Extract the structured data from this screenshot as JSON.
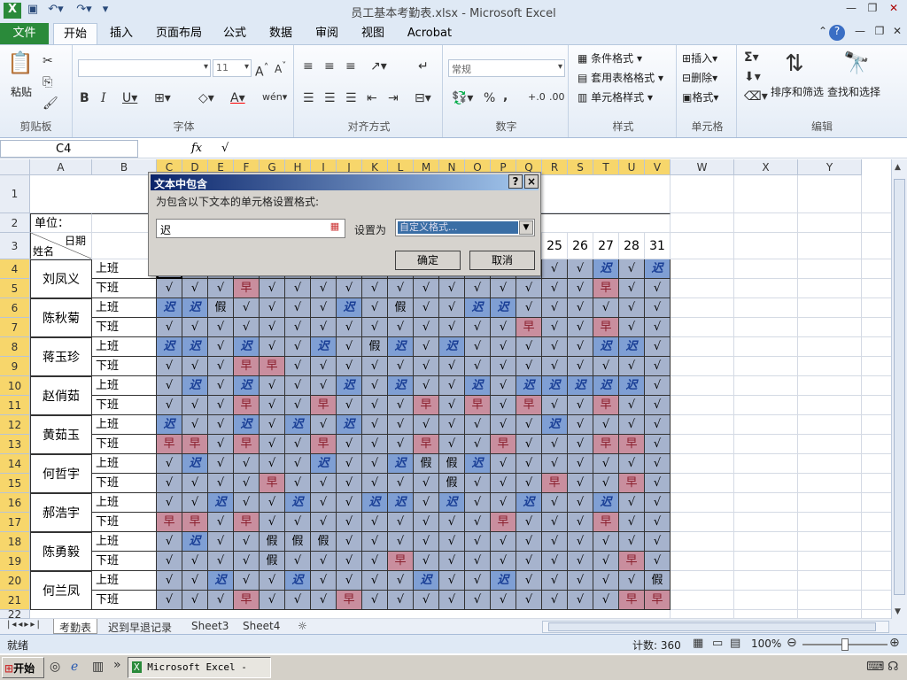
{
  "window": {
    "title": "员工基本考勤表.xlsx - Microsoft Excel"
  },
  "ribbon": {
    "tabs": [
      "文件",
      "开始",
      "插入",
      "页面布局",
      "公式",
      "数据",
      "审阅",
      "视图",
      "Acrobat"
    ],
    "clipboard": {
      "paste": "粘贴",
      "label": "剪贴板"
    },
    "font": {
      "label": "字体",
      "size": "11"
    },
    "alignment": {
      "label": "对齐方式"
    },
    "number": {
      "label": "数字",
      "format": "常规",
      "percent": "%",
      "comma": ","
    },
    "styles": {
      "label": "样式",
      "conditional": "条件格式",
      "table": "套用表格格式",
      "cell": "单元格样式"
    },
    "cells": {
      "label": "单元格",
      "insert": "插入",
      "delete": "删除",
      "format": "格式"
    },
    "editing": {
      "label": "编辑",
      "sort": "排序和筛选",
      "find": "查找和选择",
      "sigma": "Σ"
    }
  },
  "formula_bar": {
    "name_box": "C4",
    "fx": "fx",
    "value": "√"
  },
  "sheet": {
    "col_headers": [
      "A",
      "B",
      "C",
      "D",
      "E",
      "F",
      "G",
      "H",
      "I",
      "J",
      "K",
      "L",
      "M",
      "N",
      "O",
      "P",
      "Q",
      "R",
      "S",
      "T",
      "U",
      "V",
      "W",
      "X",
      "Y"
    ],
    "row_headers": [
      "1",
      "2",
      "3",
      "4",
      "5",
      "6",
      "7",
      "8",
      "9",
      "10",
      "11",
      "12",
      "13",
      "14",
      "15",
      "16",
      "17",
      "18",
      "19",
      "20",
      "21",
      "22"
    ],
    "unit_label": "单位：",
    "date_label": "日期",
    "name_label": "姓名",
    "visible_days": [
      "25",
      "26",
      "27",
      "28",
      "31"
    ],
    "shift_labels": [
      "上班",
      "下班"
    ],
    "employees": [
      "刘凤义",
      "陈秋菊",
      "蒋玉珍",
      "赵俏茹",
      "黄茹玉",
      "何哲宇",
      "郝浩宇",
      "陈勇毅",
      "何兰凤"
    ],
    "attendance": [
      [
        "",
        "",
        "",
        "",
        "",
        "",
        "",
        "",
        "",
        "",
        "",
        "",
        "",
        "",
        "",
        "√",
        "√",
        "迟",
        "√",
        "迟"
      ],
      [
        "√",
        "√",
        "√",
        "早",
        "√",
        "√",
        "√",
        "√",
        "√",
        "√",
        "√",
        "√",
        "√",
        "√",
        "√",
        "√",
        "√",
        "早",
        "√",
        "√"
      ],
      [
        "迟",
        "迟",
        "假",
        "√",
        "√",
        "√",
        "√",
        "迟",
        "√",
        "假",
        "√",
        "√",
        "迟",
        "迟",
        "√",
        "√",
        "√",
        "√",
        "√",
        "√"
      ],
      [
        "√",
        "√",
        "√",
        "√",
        "√",
        "√",
        "√",
        "√",
        "√",
        "√",
        "√",
        "√",
        "√",
        "√",
        "早",
        "√",
        "√",
        "早",
        "√",
        "√"
      ],
      [
        "迟",
        "迟",
        "√",
        "迟",
        "√",
        "√",
        "迟",
        "√",
        "假",
        "迟",
        "√",
        "迟",
        "√",
        "√",
        "√",
        "√",
        "√",
        "迟",
        "迟",
        "√"
      ],
      [
        "√",
        "√",
        "√",
        "早",
        "早",
        "√",
        "√",
        "√",
        "√",
        "√",
        "√",
        "√",
        "√",
        "√",
        "√",
        "√",
        "√",
        "√",
        "√",
        "√"
      ],
      [
        "√",
        "迟",
        "√",
        "迟",
        "√",
        "√",
        "√",
        "迟",
        "√",
        "迟",
        "√",
        "√",
        "迟",
        "√",
        "迟",
        "迟",
        "迟",
        "迟",
        "迟",
        "√"
      ],
      [
        "√",
        "√",
        "√",
        "早",
        "√",
        "√",
        "早",
        "√",
        "√",
        "√",
        "早",
        "√",
        "早",
        "√",
        "早",
        "√",
        "√",
        "早",
        "√",
        "√"
      ],
      [
        "迟",
        "√",
        "√",
        "迟",
        "√",
        "迟",
        "√",
        "迟",
        "√",
        "√",
        "√",
        "√",
        "√",
        "√",
        "√",
        "迟",
        "√",
        "√",
        "√",
        "√"
      ],
      [
        "早",
        "早",
        "√",
        "早",
        "√",
        "√",
        "早",
        "√",
        "√",
        "√",
        "早",
        "√",
        "√",
        "早",
        "√",
        "√",
        "√",
        "早",
        "早",
        "√"
      ],
      [
        "√",
        "迟",
        "√",
        "√",
        "√",
        "√",
        "迟",
        "√",
        "√",
        "迟",
        "假",
        "假",
        "迟",
        "√",
        "√",
        "√",
        "√",
        "√",
        "√",
        "√"
      ],
      [
        "√",
        "√",
        "√",
        "√",
        "早",
        "√",
        "√",
        "√",
        "√",
        "√",
        "√",
        "假",
        "√",
        "√",
        "√",
        "早",
        "√",
        "√",
        "早",
        "√"
      ],
      [
        "√",
        "√",
        "迟",
        "√",
        "√",
        "迟",
        "√",
        "√",
        "迟",
        "迟",
        "√",
        "迟",
        "√",
        "√",
        "迟",
        "√",
        "√",
        "迟",
        "√",
        "√"
      ],
      [
        "早",
        "早",
        "√",
        "早",
        "√",
        "√",
        "√",
        "√",
        "√",
        "√",
        "√",
        "√",
        "√",
        "早",
        "√",
        "√",
        "√",
        "早",
        "√",
        "√"
      ],
      [
        "√",
        "迟",
        "√",
        "√",
        "假",
        "假",
        "假",
        "√",
        "√",
        "√",
        "√",
        "√",
        "√",
        "√",
        "√",
        "√",
        "√",
        "√",
        "√",
        "√"
      ],
      [
        "√",
        "√",
        "√",
        "√",
        "假",
        "√",
        "√",
        "√",
        "√",
        "早",
        "√",
        "√",
        "√",
        "√",
        "√",
        "√",
        "√",
        "√",
        "早",
        "√"
      ],
      [
        "√",
        "√",
        "迟",
        "√",
        "√",
        "迟",
        "√",
        "√",
        "√",
        "√",
        "迟",
        "√",
        "√",
        "迟",
        "√",
        "√",
        "√",
        "√",
        "√",
        "假"
      ],
      [
        "√",
        "√",
        "√",
        "早",
        "√",
        "√",
        "√",
        "早",
        "√",
        "√",
        "√",
        "√",
        "√",
        "√",
        "√",
        "√",
        "√",
        "√",
        "早",
        "早"
      ]
    ]
  },
  "dialog": {
    "title": "文本中包含",
    "prompt": "为包含以下文本的单元格设置格式:",
    "input_value": "迟",
    "set_as_label": "设置为",
    "format_value": "自定义格式...",
    "ok": "确定",
    "cancel": "取消",
    "help": "?",
    "close": "×"
  },
  "sheet_tabs": [
    "考勤表",
    "迟到早退记录",
    "Sheet3",
    "Sheet4"
  ],
  "status": {
    "ready": "就绪",
    "count": "计数: 360",
    "zoom": "100%"
  },
  "taskbar": {
    "start": "开始",
    "item": "Microsoft Excel - ..."
  }
}
